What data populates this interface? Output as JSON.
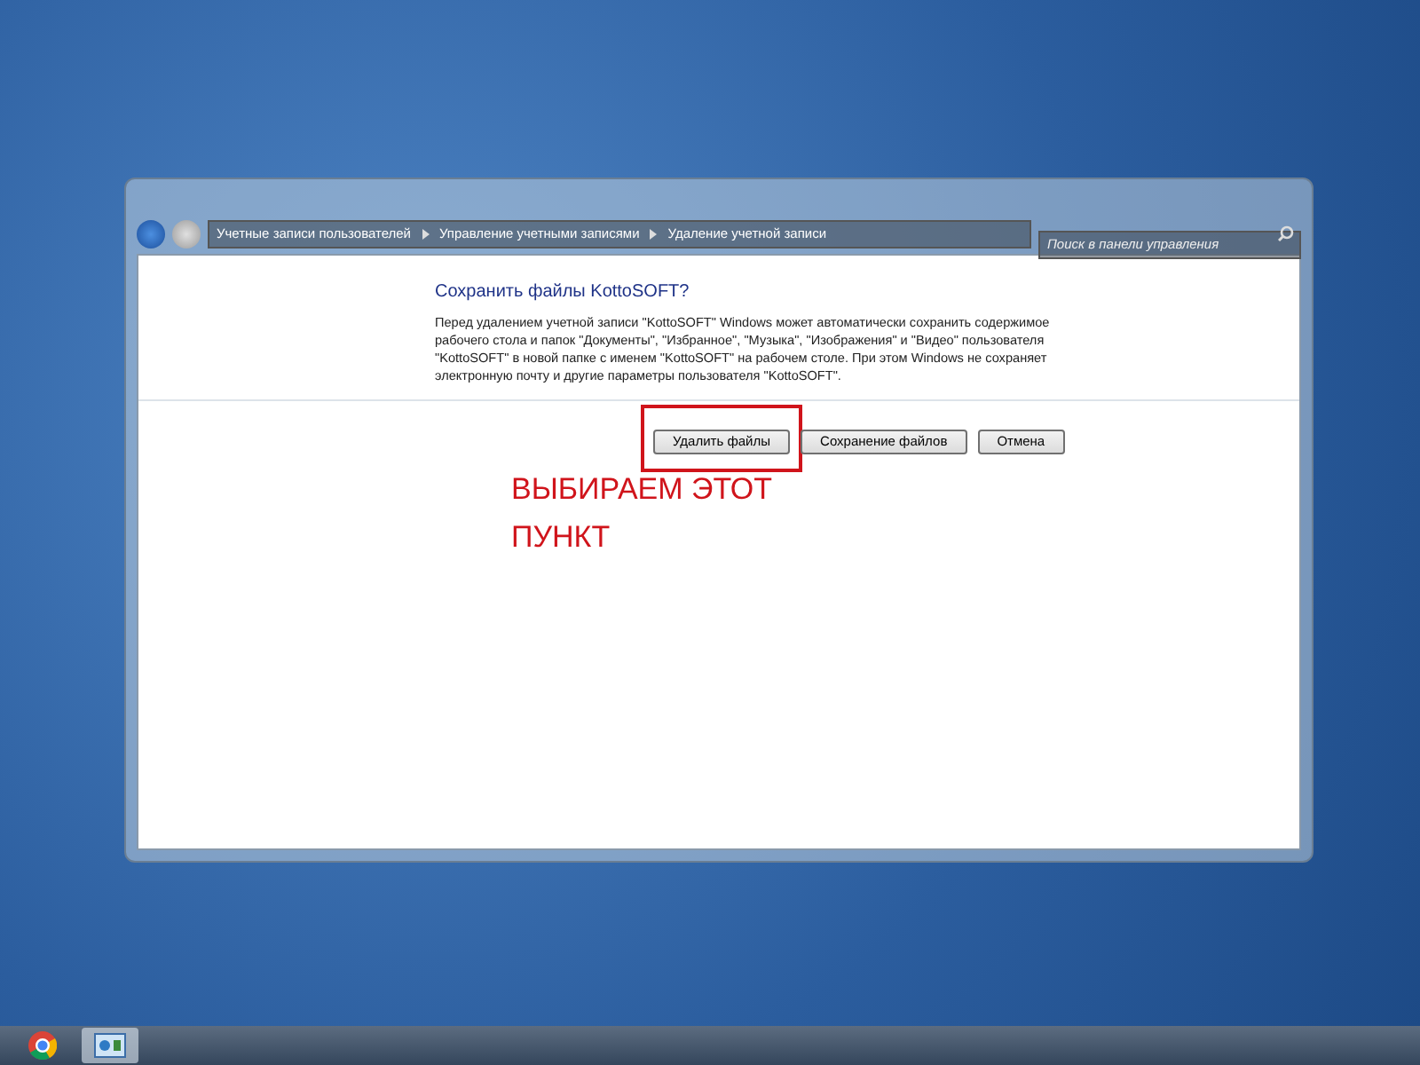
{
  "window": {
    "breadcrumbs": [
      "Учетные записи пользователей",
      "Управление учетными записями",
      "Удаление учетной записи"
    ],
    "search": {
      "placeholder": "Поиск в панели управления"
    },
    "heading": "Сохранить файлы KottoSOFT?",
    "paragraph": "Перед удалением учетной записи \"KottoSOFT\" Windows может автоматически сохранить содержимое рабочего стола и папок \"Документы\", \"Избранное\", \"Музыка\", \"Изображения\" и \"Видео\" пользователя \"KottoSOFT\" в новой папке с именем \"KottoSOFT\" на рабочем столе. При этом Windows не сохраняет электронную почту и другие параметры пользователя \"KottoSOFT\".",
    "buttons": [
      {
        "label": "Удалить файлы",
        "highlighted": true
      },
      {
        "label": "Сохранение файлов",
        "highlighted": false
      },
      {
        "label": "Отмена",
        "highlighted": false
      }
    ]
  },
  "annotation": "ВЫБИРАЕМ ЭТОТ ПУНКТ",
  "taskbar": {
    "items": [
      {
        "kind": "browser",
        "selected": false
      },
      {
        "kind": "control-panel",
        "selected": true
      }
    ]
  }
}
